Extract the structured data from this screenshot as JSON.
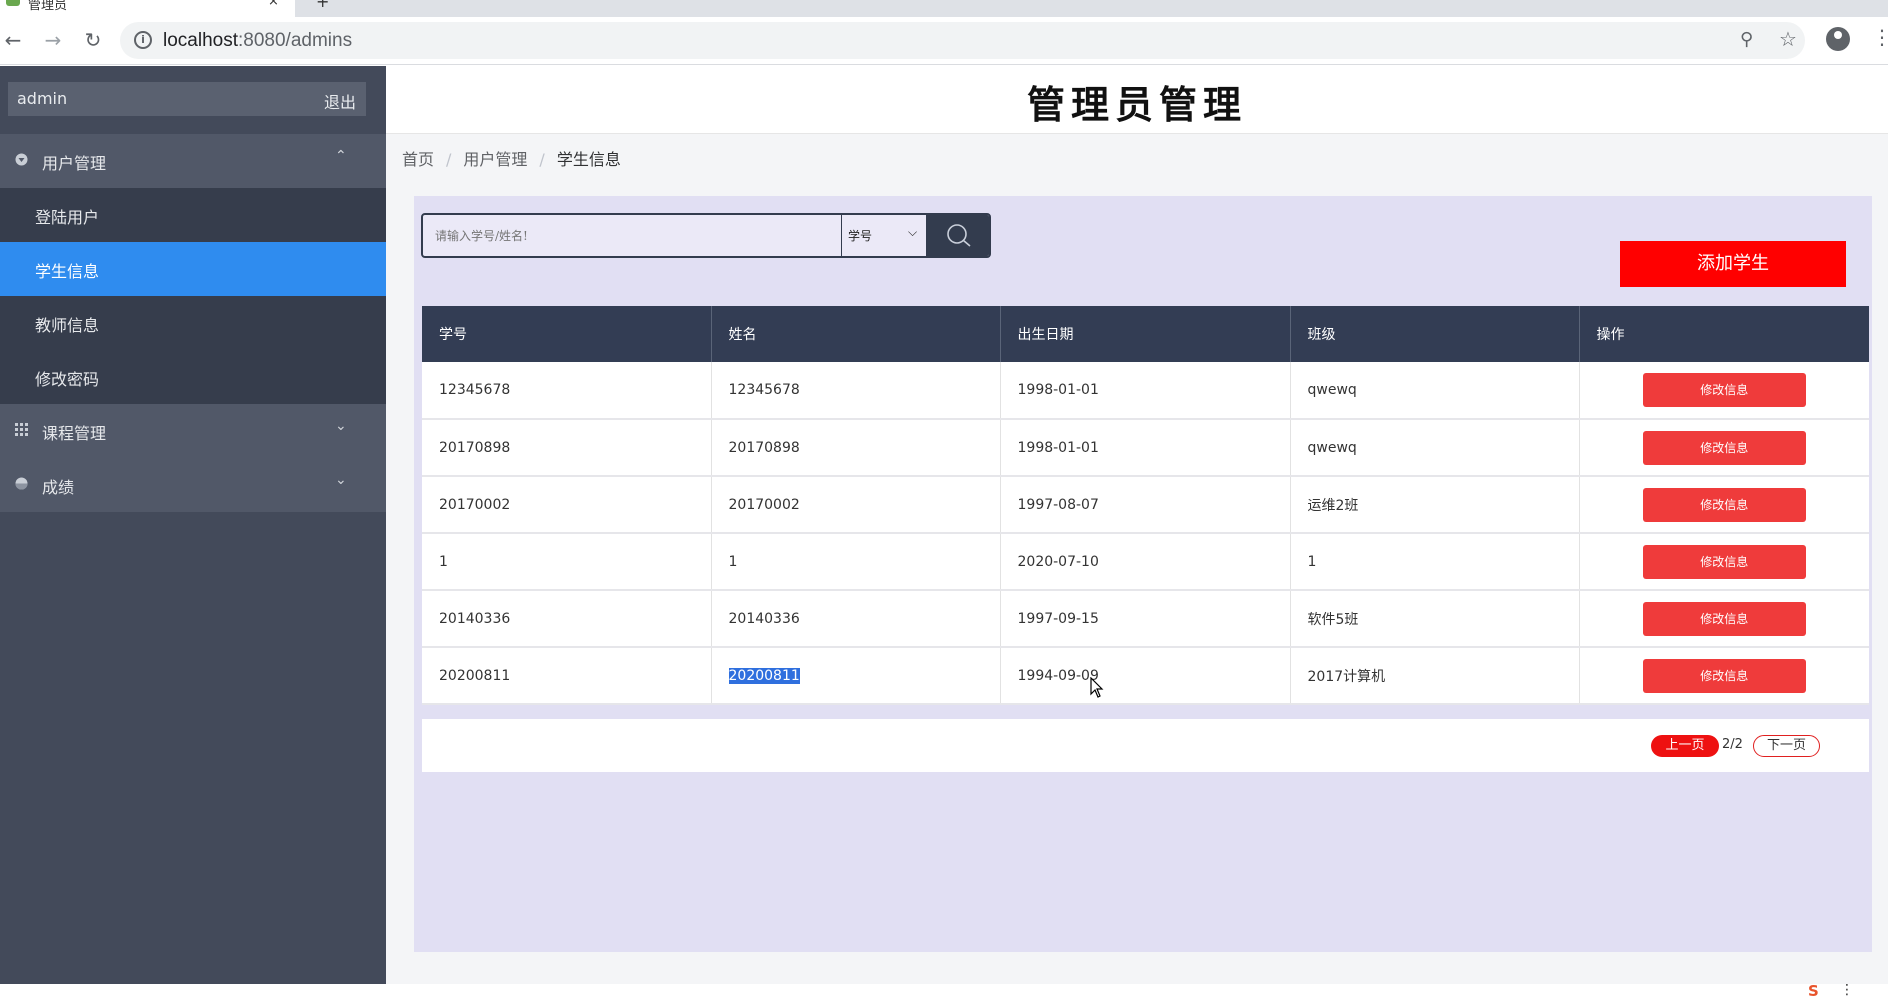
{
  "browser": {
    "tab_title": "管理员",
    "tab_close": "×",
    "new_tab": "+",
    "url_host": "localhost",
    "url_rest": ":8080/admins",
    "window_min": "–"
  },
  "sidebar": {
    "username": "admin",
    "logout": "退出",
    "groups": [
      {
        "label": "用户管理",
        "icon": "caret-circle-icon",
        "expanded": true,
        "items": [
          {
            "label": "登陆用户",
            "active": false
          },
          {
            "label": "学生信息",
            "active": true
          },
          {
            "label": "教师信息",
            "active": false
          },
          {
            "label": "修改密码",
            "active": false
          }
        ]
      },
      {
        "label": "课程管理",
        "icon": "grid-icon",
        "expanded": false
      },
      {
        "label": "成绩",
        "icon": "pie-icon",
        "expanded": false
      }
    ]
  },
  "header": {
    "title": "管理员管理"
  },
  "breadcrumb": [
    "首页",
    "用户管理",
    "学生信息"
  ],
  "search": {
    "placeholder": "请输入学号/姓名!",
    "field": "学号"
  },
  "add_button": "添加学生",
  "table": {
    "columns": [
      "学号",
      "姓名",
      "出生日期",
      "班级",
      "操作"
    ],
    "rows": [
      [
        "12345678",
        "12345678",
        "1998-01-01",
        "qwewq"
      ],
      [
        "20170898",
        "20170898",
        "1998-01-01",
        "qwewq"
      ],
      [
        "20170002",
        "20170002",
        "1997-08-07",
        "运维2班"
      ],
      [
        "1",
        "1",
        "2020-07-10",
        "1"
      ],
      [
        "20140336",
        "20140336",
        "1997-09-15",
        "软件5班"
      ],
      [
        "20200811",
        "20200811",
        "1994-09-09",
        "2017计算机"
      ]
    ],
    "action_label": "修改信息"
  },
  "pager": {
    "prev": "上一页",
    "info": "2/2",
    "next": "下一页"
  },
  "colors": {
    "sidebar_bg": "#434a5a",
    "active_item": "#2f8cef",
    "table_header": "#333d54",
    "panel_bg": "#e1dff3",
    "add_button": "#ff0000",
    "edit_button": "#ef3b3b"
  }
}
